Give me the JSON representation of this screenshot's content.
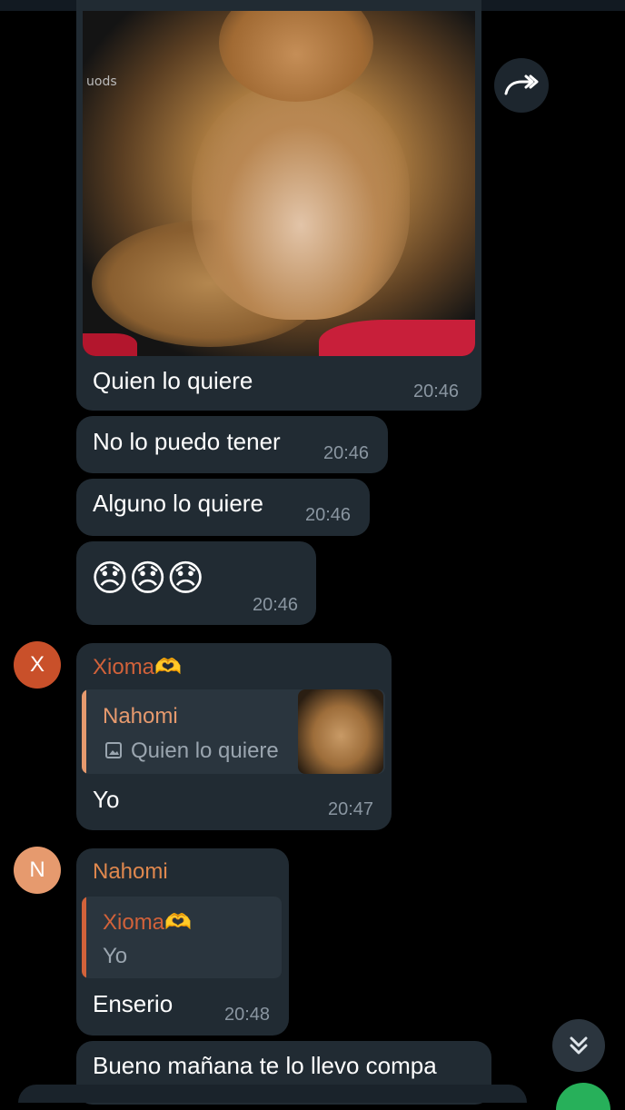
{
  "colors": {
    "background": "#000000",
    "bubble": "#212b33",
    "time": "#8a96a1",
    "sender_nahomi": "#e0884e",
    "sender_xioma": "#d2623a",
    "avatar_x": "#c9502a",
    "avatar_n": "#e69a6e",
    "accent_green": "#27b05a"
  },
  "messages": [
    {
      "text": "Quien lo quiere",
      "time": "20:46",
      "has_photo": true
    },
    {
      "text": "No lo puedo tener",
      "time": "20:46"
    },
    {
      "text": "Alguno lo quiere",
      "time": "20:46"
    },
    {
      "text": "😞😞😞",
      "time": "20:46"
    }
  ],
  "photo_watermark": "uods",
  "reply1": {
    "avatar_letter": "X",
    "sender": "Xioma🫶",
    "quoted_name": "Nahomi",
    "quoted_text": "Quien lo quiere",
    "quoted_icon": "image-icon",
    "text": "Yo",
    "time": "20:47"
  },
  "reply2": {
    "avatar_letter": "N",
    "sender": "Nahomi",
    "quoted_name": "Xioma🫶",
    "quoted_text": "Yo",
    "text": "Enserio",
    "time": "20:48"
  },
  "last_message": {
    "text": "Bueno mañana te lo llevo compa"
  },
  "icons": {
    "forward": "forward-arrow-icon",
    "scroll_down": "double-chevron-down-icon"
  }
}
